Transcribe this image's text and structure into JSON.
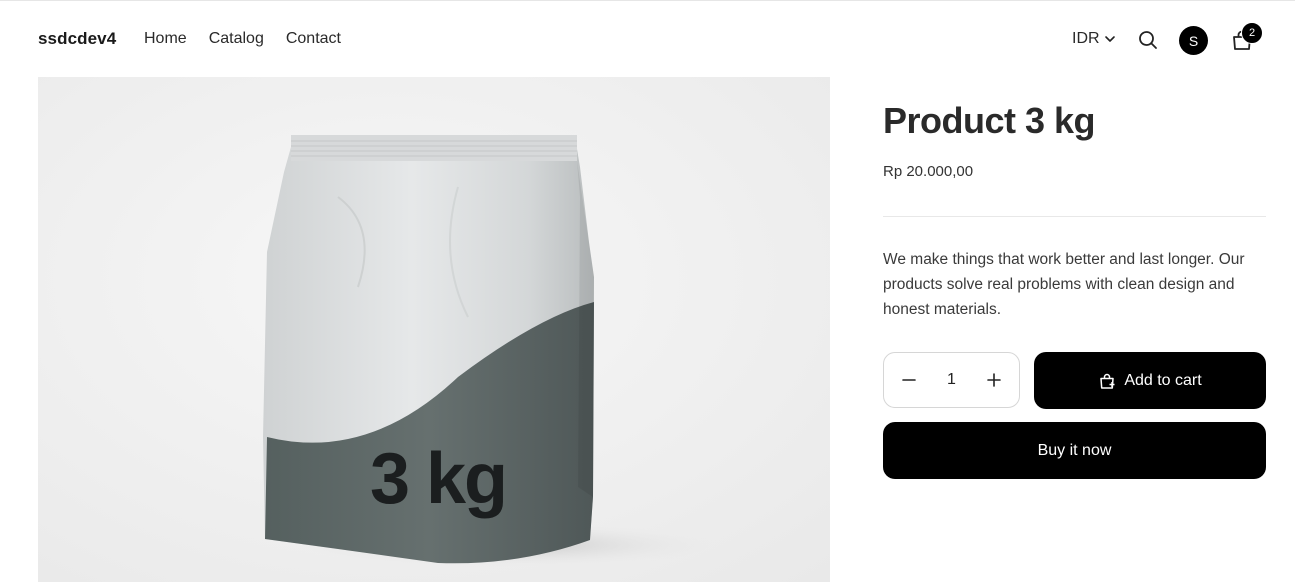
{
  "header": {
    "brand": "ssdcdev4",
    "nav": [
      "Home",
      "Catalog",
      "Contact"
    ],
    "currency": "IDR",
    "avatar_letter": "S",
    "cart_count": "2",
    "icons": [
      "chevron-down-icon",
      "search-icon",
      "cart-icon"
    ]
  },
  "product": {
    "image_text": "3 kg",
    "title": "Product 3 kg",
    "price": "Rp 20.000,00",
    "description": "We make things that work better and last longer. Our products solve real problems with clean design and honest materials.",
    "quantity": "1",
    "decrease_label": "−",
    "increase_label": "+",
    "add_to_cart_label": "Add to cart",
    "buy_now_label": "Buy it now"
  },
  "colors": {
    "button_bg": "#000000",
    "bag_top": "#dcdedf",
    "bag_bottom": "#5f6a6d"
  }
}
